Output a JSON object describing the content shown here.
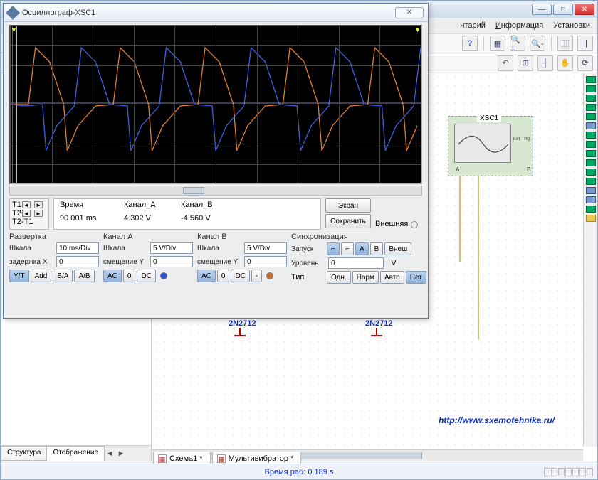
{
  "main": {
    "menu": {
      "item1": "нтарий",
      "item2_pre": "И",
      "item2_rest": "нформация",
      "item3": "Установки"
    },
    "tb1": {
      "help": "?"
    }
  },
  "canvas": {
    "xsc_label": "XSC1",
    "xsc_ext": "Ext Trig",
    "xsc_ab": "A",
    "comp1": "2N2712",
    "comp2": "2N2712",
    "url": "http://www.sxemotehnika.ru/"
  },
  "left_tabs": {
    "t1": "Структура",
    "t2": "Отображение"
  },
  "doc_tabs": {
    "t1": "Схема1 *",
    "t2": "Мультивибратор *"
  },
  "status": {
    "runtime_label": "Время раб:",
    "runtime_value": "0.189 s"
  },
  "scope": {
    "title": "Осциллограф-XSC1",
    "readout": {
      "t1": "T1",
      "t2": "T2",
      "dt": "T2-T1",
      "h_time": "Время",
      "h_cha": "Канал_A",
      "h_chb": "Канал_B",
      "time_v": "90.001 ms",
      "cha_v": "4.302 V",
      "chb_v": "-4.560 V",
      "btn_screen": "Экран",
      "btn_save": "Сохранить",
      "ext_label": "Внешняя"
    },
    "sweep": {
      "hdr": "Развертка",
      "scale_l": "Шкала",
      "scale_v": "10 ms/Div",
      "delay_l": "задержка X",
      "delay_v": "0",
      "b_yt": "Y/T",
      "b_add": "Add",
      "b_ba": "B/A",
      "b_ab": "A/B"
    },
    "cha": {
      "hdr": "Канал A",
      "scale_l": "Шкала",
      "scale_v": "5 V/Div",
      "off_l": "смещение Y",
      "off_v": "0",
      "b_ac": "AC",
      "b_0": "0",
      "b_dc": "DC"
    },
    "chb": {
      "hdr": "Канал B",
      "scale_l": "Шкала",
      "scale_v": "5 V/Div",
      "off_l": "смещение Y",
      "off_v": "0",
      "b_ac": "AC",
      "b_0": "0",
      "b_dc": "DC",
      "b_minus": "-"
    },
    "sync": {
      "hdr": "Синхронизация",
      "launch_l": "Запуск",
      "edge_up": "⌐",
      "edge_dn": "⌐",
      "sA": "A",
      "sB": "B",
      "sExt": "Внеш",
      "level_l": "Уровень",
      "level_v": "0",
      "level_u": "V",
      "type_l": "Тип",
      "b_once": "Одн.",
      "b_norm": "Норм",
      "b_auto": "Авто",
      "b_none": "Нет"
    }
  }
}
